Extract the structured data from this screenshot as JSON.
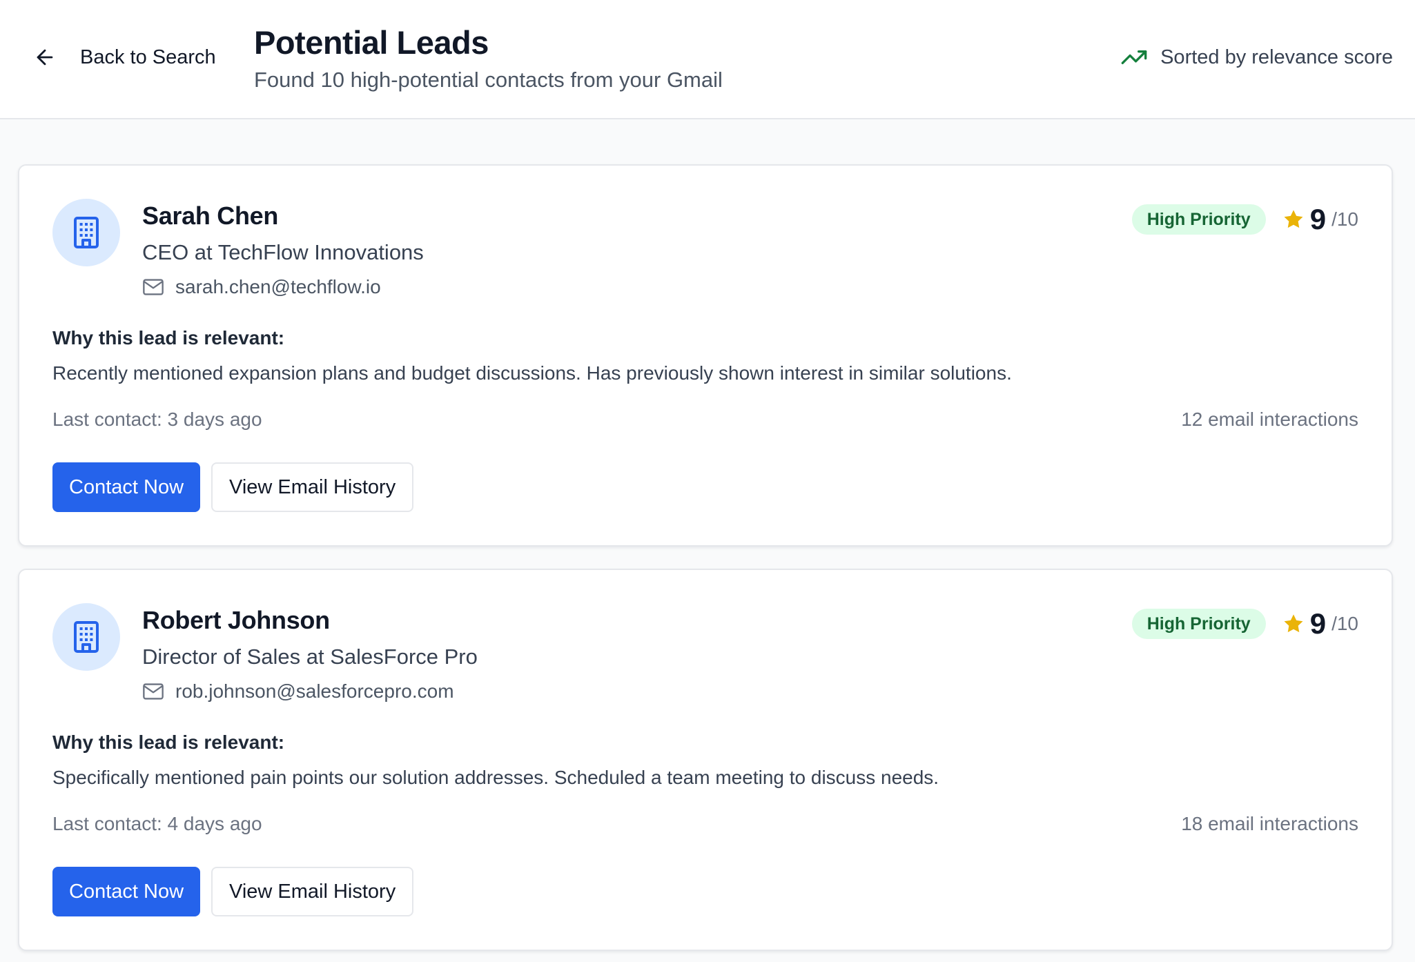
{
  "header": {
    "back_label": "Back to Search",
    "title": "Potential Leads",
    "subtitle": "Found 10 high-potential contacts from your Gmail",
    "sort_label": "Sorted by relevance score"
  },
  "colors": {
    "accent": "#2563eb",
    "badge_bg": "#dcfce7",
    "badge_text": "#166534",
    "trend_icon": "#15803d",
    "star": "#eab308",
    "avatar_bg": "#dbeafe"
  },
  "icons": {
    "back": "arrow-left-icon",
    "sort": "trending-up-icon",
    "avatar": "building-icon",
    "email": "mail-icon",
    "score": "star-icon"
  },
  "leads": [
    {
      "name": "Sarah Chen",
      "role": "CEO at TechFlow Innovations",
      "email": "sarah.chen@techflow.io",
      "priority": "High Priority",
      "score": "9",
      "score_max": "/10",
      "why_heading": "Why this lead is relevant:",
      "why_text": "Recently mentioned expansion plans and budget discussions. Has previously shown interest in similar solutions.",
      "last_contact": "Last contact: 3 days ago",
      "interactions": "12 email interactions",
      "primary_action": "Contact Now",
      "secondary_action": "View Email History"
    },
    {
      "name": "Robert Johnson",
      "role": "Director of Sales at SalesForce Pro",
      "email": "rob.johnson@salesforcepro.com",
      "priority": "High Priority",
      "score": "9",
      "score_max": "/10",
      "why_heading": "Why this lead is relevant:",
      "why_text": "Specifically mentioned pain points our solution addresses. Scheduled a team meeting to discuss needs.",
      "last_contact": "Last contact: 4 days ago",
      "interactions": "18 email interactions",
      "primary_action": "Contact Now",
      "secondary_action": "View Email History"
    }
  ]
}
